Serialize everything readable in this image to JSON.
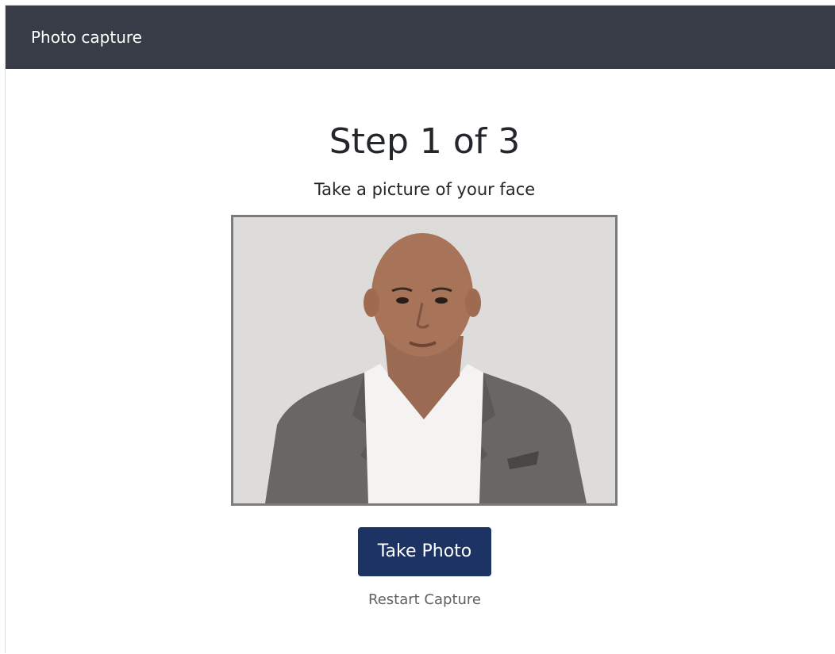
{
  "header": {
    "title": "Photo capture"
  },
  "main": {
    "step_title": "Step 1 of 3",
    "instruction": "Take a picture of your face",
    "take_photo_label": "Take Photo",
    "restart_label": "Restart Capture"
  },
  "colors": {
    "header_bg": "#383c46",
    "primary_button": "#1c3363",
    "photo_border": "#7b7b7b",
    "link_text": "#5f6165"
  }
}
